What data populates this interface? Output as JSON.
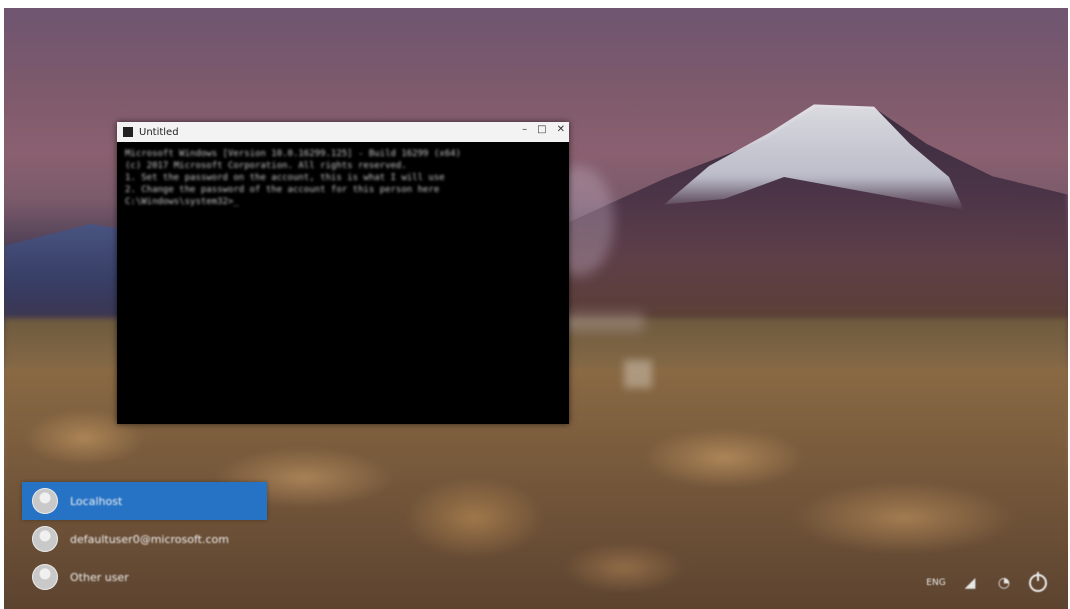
{
  "window": {
    "title": "Untitled",
    "controls": [
      "–",
      "□",
      "✕"
    ],
    "lines": [
      "Microsoft Windows [Version 10.0.16299.125] - Build 16299 (x64)",
      "(c) 2017 Microsoft Corporation. All rights reserved.",
      "",
      "1. Set the password on the account, this is what I will use",
      "2. Change the password of the account for this person here",
      "",
      "C:\\Windows\\system32>_"
    ]
  },
  "users": [
    {
      "name": "Localhost",
      "selected": true
    },
    {
      "name": "defaultuser0@microsoft.com",
      "selected": false
    },
    {
      "name": "Other user",
      "selected": false
    }
  ],
  "tray": [
    {
      "icon": "language-icon",
      "glyph": "ENG"
    },
    {
      "icon": "network-icon",
      "glyph": "◢"
    },
    {
      "icon": "ease-of-access-icon",
      "glyph": "◔"
    },
    {
      "icon": "power-icon",
      "glyph": ""
    }
  ],
  "colors": {
    "selected_user": "#2673c5",
    "console_bg": "#000000"
  }
}
